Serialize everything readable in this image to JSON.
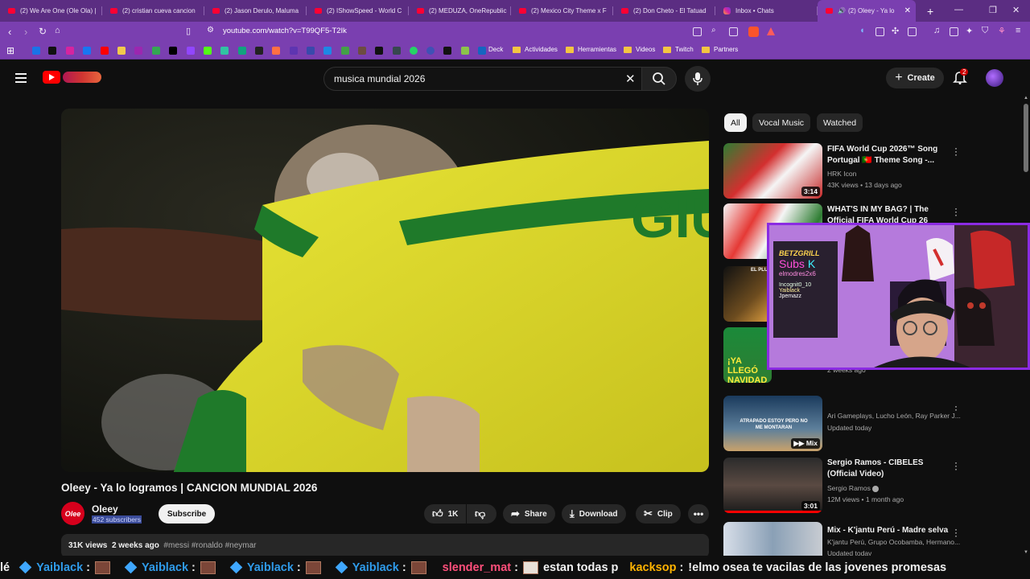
{
  "browser": {
    "tabs": [
      {
        "title": "(2) We Are One (Ole Ola) |",
        "icon": "youtube-icon"
      },
      {
        "title": "(2) cristian cueva cancion",
        "icon": "youtube-icon"
      },
      {
        "title": "(2) Jason Derulo, Maluma",
        "icon": "youtube-icon"
      },
      {
        "title": "(2) IShowSpeed - World C",
        "icon": "youtube-icon"
      },
      {
        "title": "(2) MEDUZA, OneRepublic",
        "icon": "youtube-icon"
      },
      {
        "title": "(2) Mexico City Theme x F",
        "icon": "youtube-icon"
      },
      {
        "title": "(2) Don Cheto - El Tatuad",
        "icon": "youtube-icon"
      },
      {
        "title": "Inbox • Chats",
        "icon": "instagram-icon"
      },
      {
        "title": "(2) Oleey - Ya lo lo",
        "icon": "youtube-icon"
      }
    ],
    "new_tab_symbol": "+",
    "url": "youtube.com/watch?v=T99QF5-T2Ik",
    "bookmark_folders": [
      "Deck",
      "Actividades",
      "Herramientas",
      "Videos",
      "Twitch",
      "Partners"
    ]
  },
  "youtube": {
    "search_query": "musica mundial 2026",
    "create_label": "Create",
    "notification_count": "2",
    "video": {
      "title": "Oleey - Ya lo logramos | CANCION MUNDIAL 2026",
      "channel": "Oleey",
      "channel_avatar_text": "Olee",
      "subscribers": "452 subscribers",
      "subscribe_label": "Subscribe",
      "likes": "1K",
      "share_label": "Share",
      "download_label": "Download",
      "clip_label": "Clip",
      "views": "31K views",
      "date": "2 weeks ago",
      "tags": "#messi #ronaldo #neymar",
      "jersey_text": "GIU"
    },
    "chips": [
      "All",
      "Vocal Music",
      "Watched"
    ],
    "related": [
      {
        "title_l1": "FIFA World Cup 2026™ Song",
        "title_l2": "Portugal 🇵🇹 Theme Song -...",
        "channel": "HRK Icon",
        "stats": "43K views • 13 days ago",
        "duration": "3:14"
      },
      {
        "title_l1": "WHAT'S IN MY BAG? | The",
        "title_l2": "Official FIFA World Cup 26"
      },
      {
        "stats": "2 weeks ago",
        "thumb_text": "¡YA LLEGÓ NAVIDAD",
        "thumb_top": "EL PLU"
      },
      {
        "channel": "Ari Gameplays, Lucho León, Ray Parker J...",
        "stats": "Updated today",
        "thumb_text": "ATRAPADO ESTOY PERO NO ME MONTARAN",
        "badge": "Mix"
      },
      {
        "title_l1": "Sergio Ramos - CIBELES",
        "title_l2": "(Official Video)",
        "channel": "Sergio Ramos",
        "stats": "12M views • 1 month ago",
        "duration": "3:01"
      },
      {
        "title_l1": "Mix - K'jantu Perú - Madre selva",
        "channel": "K'jantu Perú, Grupo Ocobamba, Hermano...",
        "stats": "Updated today"
      }
    ]
  },
  "webcam": {
    "neon_lines": [
      "BETZGRILL",
      "Subs",
      "elmodres2x6",
      "Incognit0_10",
      "Yaiblack",
      "Jpemazz"
    ],
    "count_glyph": "K"
  },
  "chat_ticker": {
    "lead": "lé",
    "entries": [
      {
        "user": "Yaiblack",
        "sep": ":"
      },
      {
        "user": "Yaiblack",
        "sep": ":"
      },
      {
        "user": "Yaiblack",
        "sep": ":"
      },
      {
        "user": "Yaiblack",
        "sep": ":"
      },
      {
        "user": "slender_mat",
        "sep": ":",
        "message": "estan todas p"
      },
      {
        "user": "kacksop",
        "sep": ":",
        "message": "!elmo osea te vacilas de las jovenes promesas"
      }
    ],
    "colors": {
      "yaiblack": "#2f9bea",
      "slender_mat": "#ff4f7b",
      "kacksop": "#ffb300"
    }
  }
}
